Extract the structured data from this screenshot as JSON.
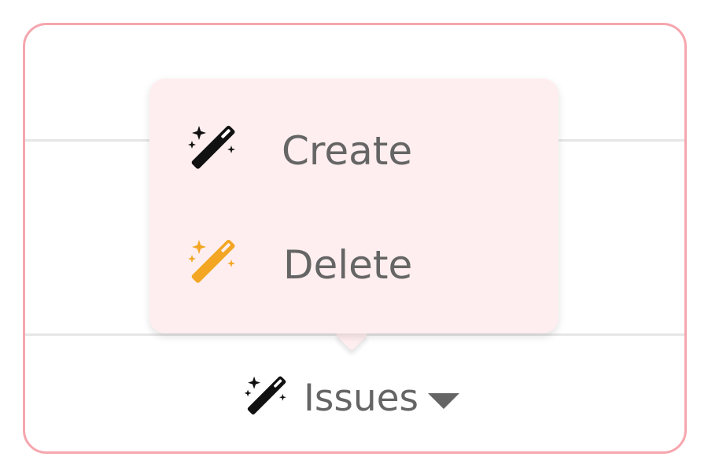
{
  "menu": {
    "items": [
      {
        "label": "Create",
        "icon": "magic-wand-icon",
        "icon_color": "#111111"
      },
      {
        "label": "Delete",
        "icon": "magic-wand-icon",
        "icon_color": "#f2a623"
      }
    ]
  },
  "trigger": {
    "label": "Issues",
    "icon": "magic-wand-icon",
    "icon_color": "#111111",
    "caret": "chevron-down-icon"
  },
  "colors": {
    "frame_border": "#f6a6ae",
    "popup_background": "#ffeeef",
    "text": "#656565"
  }
}
